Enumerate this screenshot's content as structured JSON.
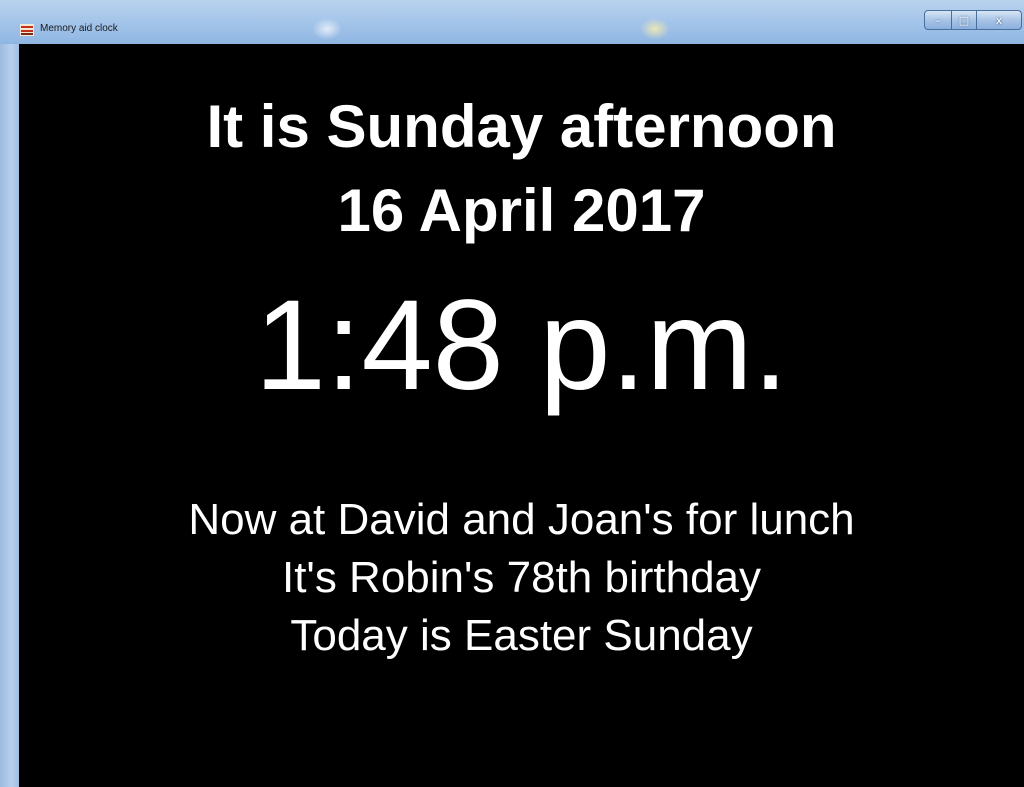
{
  "window": {
    "title": "Memory aid clock",
    "controls": {
      "minimize": "–",
      "maximize": "□",
      "close": "x"
    },
    "icon": "clock-app-icon"
  },
  "clock": {
    "day_line": "It is Sunday afternoon",
    "date_line": "16 April 2017",
    "time": "1:48 p.m."
  },
  "messages": [
    "Now at David and Joan's for lunch",
    "It's Robin's 78th birthday",
    "Today is Easter Sunday"
  ],
  "colors": {
    "background": "#000000",
    "text": "#ffffff",
    "titlebar": "#a6c6ea"
  }
}
